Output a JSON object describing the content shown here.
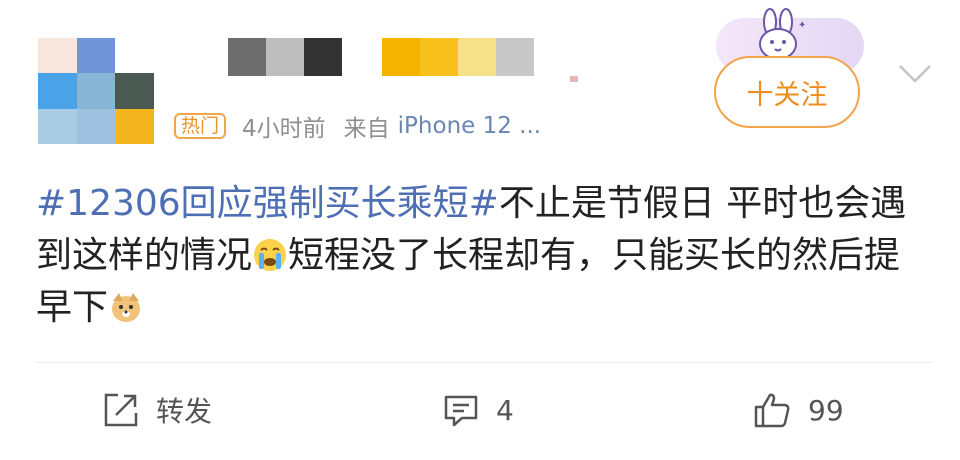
{
  "post": {
    "hot_badge": "热门",
    "time": "4小时前",
    "source_prefix": "来自",
    "device": "iPhone 12 ...",
    "follow_label": "十关注",
    "hashtag": "#12306回应强制买长乘短#",
    "text_part1": "不止是节假日 平时也会遇到这样的情况",
    "text_part2": "短程没了长程却有，只能买长的然后提早下"
  },
  "actions": {
    "repost_label": "转发",
    "comment_count": "4",
    "like_count": "99"
  },
  "colors": {
    "hashtag": "#4e6fb3",
    "accent": "#ef8d1b",
    "meta": "#8f8f8f"
  },
  "icons": [
    "bunny-sticker-icon",
    "chevron-down-icon",
    "crying-emoji-icon",
    "dog-emoji-icon",
    "repost-icon",
    "comment-icon",
    "like-icon"
  ]
}
